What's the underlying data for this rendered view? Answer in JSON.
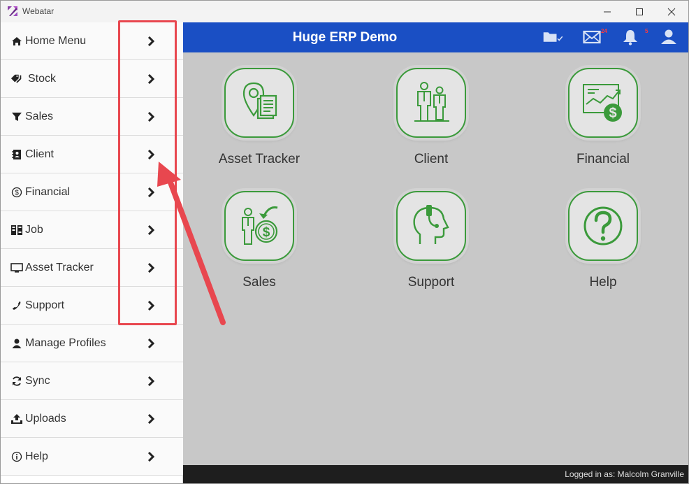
{
  "window": {
    "title": "Webatar"
  },
  "sidebar": {
    "items": [
      {
        "label": "Home Menu",
        "icon": "home-icon"
      },
      {
        "label": "Stock",
        "icon": "tags-icon"
      },
      {
        "label": "Sales",
        "icon": "filter-icon"
      },
      {
        "label": "Client",
        "icon": "contact-book-icon"
      },
      {
        "label": "Financial",
        "icon": "dollar-circle-icon"
      },
      {
        "label": "Job",
        "icon": "job-icon"
      },
      {
        "label": "Asset Tracker",
        "icon": "monitor-icon"
      },
      {
        "label": "Support",
        "icon": "phone-icon"
      },
      {
        "label": "Manage Profiles",
        "icon": "user-icon"
      },
      {
        "label": "Sync",
        "icon": "refresh-icon"
      },
      {
        "label": "Uploads",
        "icon": "upload-icon"
      },
      {
        "label": "Help",
        "icon": "info-circle-icon"
      }
    ]
  },
  "header": {
    "title": "Huge ERP Demo",
    "mail_badge": "24",
    "bell_badge": "5"
  },
  "tiles": [
    {
      "label": "Asset Tracker",
      "icon": "location-document-icon"
    },
    {
      "label": "Client",
      "icon": "two-people-icon"
    },
    {
      "label": "Financial",
      "icon": "chart-dollar-icon"
    },
    {
      "label": "Sales",
      "icon": "person-dollar-icon"
    },
    {
      "label": "Support",
      "icon": "headset-head-icon"
    },
    {
      "label": "Help",
      "icon": "question-circle-icon"
    }
  ],
  "footer": {
    "status": "Logged in as: Malcolm Granville"
  },
  "colors": {
    "header_bg": "#1a4fc4",
    "tile_stroke": "#3b9a3b",
    "annotation": "#e8474f"
  }
}
